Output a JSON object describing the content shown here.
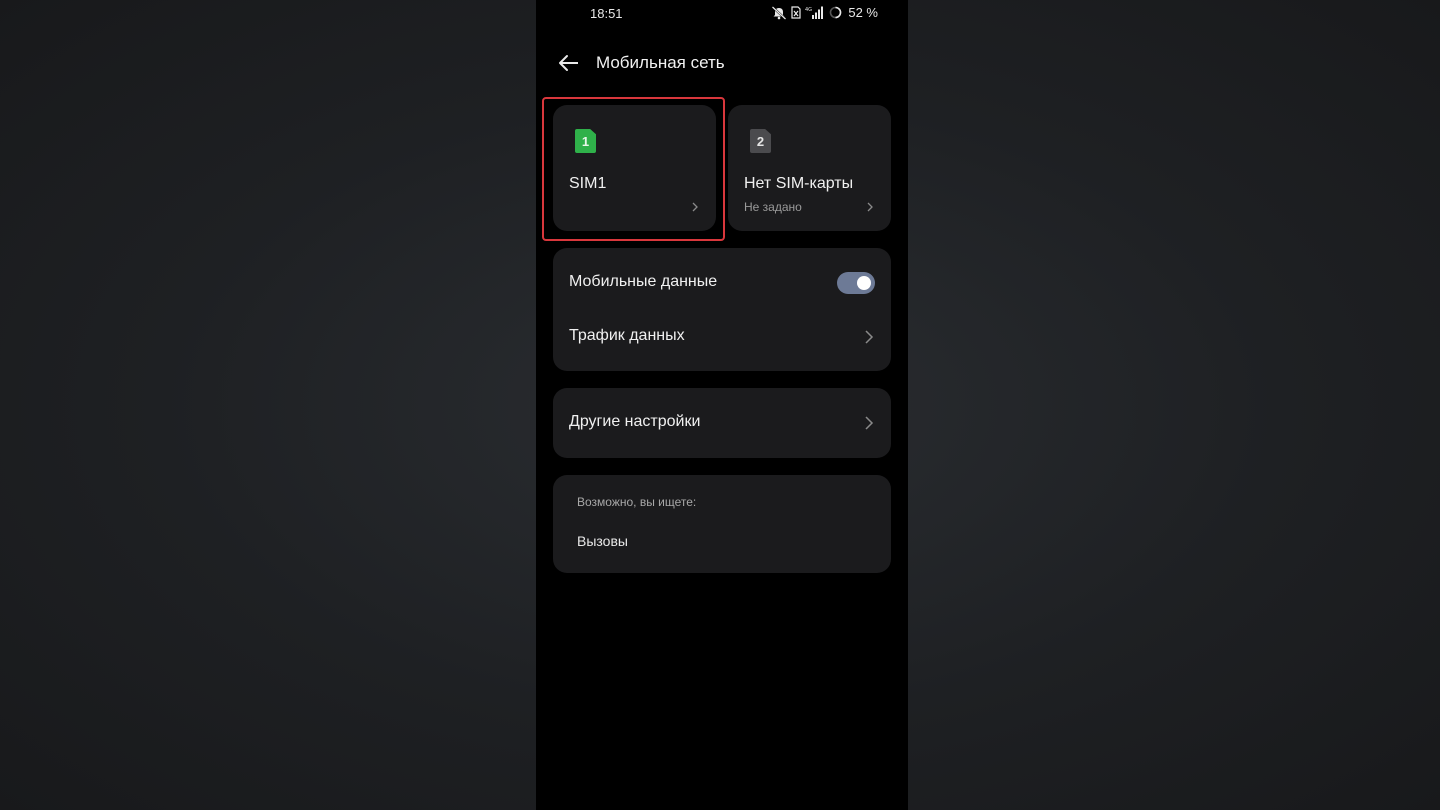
{
  "status_bar": {
    "time": "18:51",
    "network_label": "4G",
    "battery": "52 %"
  },
  "header": {
    "title": "Мобильная сеть",
    "back_icon": "arrow-left-icon"
  },
  "sim_cards": [
    {
      "badge": "1",
      "title": "SIM1",
      "subtitle": "",
      "badge_color": "#2fb14a",
      "selected": true
    },
    {
      "badge": "2",
      "title": "Нет SIM-карты",
      "subtitle": "Не задано",
      "badge_color": "#4b4b4e",
      "selected": false
    }
  ],
  "data_card": {
    "mobile_data_label": "Мобильные данные",
    "mobile_data_enabled": true,
    "traffic_label": "Трафик данных"
  },
  "other_card": {
    "label": "Другие настройки"
  },
  "suggest_card": {
    "heading": "Возможно, вы ищете:",
    "link": "Вызовы"
  },
  "colors": {
    "highlight": "#d9373c",
    "toggle_on": "#6d7a96",
    "card_bg": "#1b1b1d"
  }
}
